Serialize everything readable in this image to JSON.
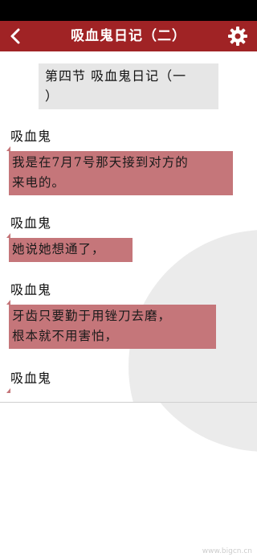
{
  "header": {
    "title": "吸血鬼日记（二）",
    "back_icon": "chevron-left-icon",
    "settings_icon": "gear-icon"
  },
  "colors": {
    "header_bg": "#a02325",
    "bubble_bg": "#c5767a",
    "section_bg": "#e6e6e6"
  },
  "section": {
    "title_line1": "第四节 吸血鬼日记（一",
    "title_line2": "）"
  },
  "messages": [
    {
      "speaker": "吸血鬼",
      "lines": [
        "我是在7月7号那天接到对方的",
        "来电的。"
      ]
    },
    {
      "speaker": "吸血鬼",
      "lines": [
        "她说她想通了，"
      ]
    },
    {
      "speaker": "吸血鬼",
      "lines": [
        "牙齿只要勤于用锉刀去磨，",
        "根本就不用害怕，"
      ]
    },
    {
      "speaker": "吸血鬼",
      "lines": []
    }
  ],
  "watermark": "www.bigcn.cn"
}
